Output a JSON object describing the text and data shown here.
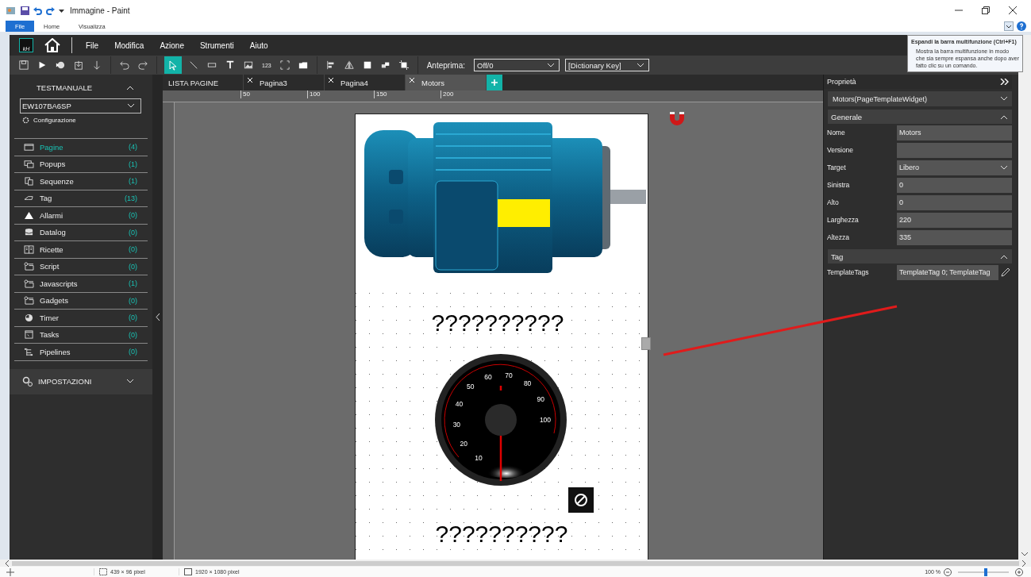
{
  "paint": {
    "title": "Immagine - Paint",
    "ribbon_tabs": [
      {
        "label": "File",
        "selected": true
      },
      {
        "label": "Home",
        "selected": false
      },
      {
        "label": "Visualizza",
        "selected": false
      }
    ],
    "tooltip": {
      "title": "Espandi la barra multifunzione (Ctrl+F1)",
      "body": "Mostra la barra multifunzione in modo che sia sempre espansa anche dopo aver fatto clic su un comando."
    },
    "status": {
      "selection": "439 × 96 pixel",
      "image_size": "1920 × 1080 pixel",
      "zoom": "100 %",
      "zoom_slider": {
        "level": 0.55
      }
    }
  },
  "app": {
    "logo": "kH",
    "menu": [
      "File",
      "Modifica",
      "Azione",
      "Strumenti",
      "Aiuto"
    ],
    "toolbar": {
      "number_tool": "123",
      "preview_label": "Anteprima:",
      "preview_value": "Off/0",
      "dictionary_value": "[Dictionary Key]"
    },
    "project": {
      "title": "TESTMANUALE",
      "device": "EW107BA6SP",
      "config": "Configurazione"
    },
    "sidebar": [
      {
        "label": "Pagine",
        "count": "(4)",
        "kind": "page",
        "selected": true
      },
      {
        "label": "Popups",
        "count": "(1)",
        "kind": "popup",
        "selected": false
      },
      {
        "label": "Sequenze",
        "count": "(1)",
        "kind": "sequence",
        "selected": false
      },
      {
        "label": "Tag",
        "count": "(13)",
        "kind": "tag",
        "selected": false
      },
      {
        "label": "Allarmi",
        "count": "(0)",
        "kind": "alarm",
        "selected": false
      },
      {
        "label": "Datalog",
        "count": "(0)",
        "kind": "database",
        "selected": false
      },
      {
        "label": "Ricette",
        "count": "(0)",
        "kind": "recipe",
        "selected": false
      },
      {
        "label": "Script",
        "count": "(0)",
        "kind": "script",
        "selected": false
      },
      {
        "label": "Javascripts",
        "count": "(1)",
        "kind": "script",
        "selected": false
      },
      {
        "label": "Gadgets",
        "count": "(0)",
        "kind": "script",
        "selected": false
      },
      {
        "label": "Timer",
        "count": "(0)",
        "kind": "timer",
        "selected": false
      },
      {
        "label": "Tasks",
        "count": "(0)",
        "kind": "tasks",
        "selected": false
      },
      {
        "label": "Pipelines",
        "count": "(0)",
        "kind": "pipeline",
        "selected": false
      }
    ],
    "settings": "IMPOSTAZIONI",
    "tabs": [
      {
        "label": "LISTA PAGINE",
        "closable": false,
        "selected": false
      },
      {
        "label": "Pagina3",
        "closable": true,
        "selected": false
      },
      {
        "label": "Pagina4",
        "closable": true,
        "selected": false
      },
      {
        "label": "Motors",
        "closable": true,
        "selected": true
      }
    ],
    "ruler": [
      "50",
      "100",
      "150",
      "200"
    ],
    "page": {
      "placeholder_texts": [
        "??????????",
        "??????????"
      ],
      "gauge_labels": [
        "10",
        "20",
        "30",
        "40",
        "50",
        "60",
        "70",
        "80",
        "90",
        "100"
      ]
    },
    "properties": {
      "title": "Proprietà",
      "object": "Motors(PageTemplateWidget)",
      "sections": [
        {
          "title": "Generale",
          "rows": [
            {
              "label": "Nome",
              "value": "Motors",
              "kind": "text"
            },
            {
              "label": "Versione",
              "value": "",
              "kind": "text"
            },
            {
              "label": "Target",
              "value": "Libero",
              "kind": "select"
            },
            {
              "label": "Sinistra",
              "value": "0",
              "kind": "text"
            },
            {
              "label": "Alto",
              "value": "0",
              "kind": "text"
            },
            {
              "label": "Larghezza",
              "value": "220",
              "kind": "text"
            },
            {
              "label": "Altezza",
              "value": "335",
              "kind": "text"
            }
          ]
        },
        {
          "title": "Tag",
          "rows": [
            {
              "label": "TemplateTags",
              "value": "TemplateTag 0; TemplateTag",
              "kind": "edit"
            }
          ]
        }
      ]
    }
  }
}
